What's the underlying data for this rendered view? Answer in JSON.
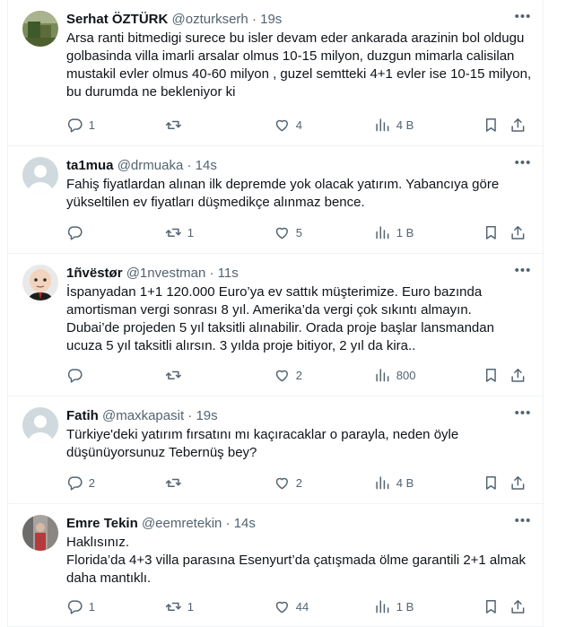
{
  "tweets": [
    {
      "name": "Serhat ÖZTÜRK",
      "handle": "@ozturkserh",
      "dot": "·",
      "time": "19s",
      "text": "Arsa ranti bitmedigi surece bu isler devam eder ankarada arazinin bol oldugu golbasinda villa imarli arsalar olmus 10-15 milyon, duzgun mimarla calisilan mustakil evler olmus 40-60 milyon , guzel semtteki 4+1 evler ise 10-15 milyon, bu durumda ne bekleniyor ki",
      "replies": "1",
      "retweets": "",
      "likes": "4",
      "views": "4 B"
    },
    {
      "name": "ta1mua",
      "handle": "@drmuaka",
      "dot": "·",
      "time": "14s",
      "text": "Fahiş fiyatlardan alınan ilk depremde yok olacak yatırım. Yabancıya göre yükseltilen ev fiyatları düşmedikçe alınmaz bence.",
      "replies": "",
      "retweets": "1",
      "likes": "5",
      "views": "1 B"
    },
    {
      "name": "1ñvëstør",
      "handle": "@1nvestman",
      "dot": "·",
      "time": "11s",
      "text": "İspanyadan 1+1 120.000 Euro’ya ev sattık müşterimize. Euro bazında amortisman vergi sonrası 8 yıl. Amerika’da vergi çok sıkıntı almayın.\nDubai’de projeden 5 yıl taksitli alınabilir. Orada proje başlar lansmandan ucuza 5 yıl taksitli alırsın. 3 yılda proje bitiyor, 2 yıl da kira..",
      "replies": "",
      "retweets": "",
      "likes": "2",
      "views": "800"
    },
    {
      "name": "Fatih",
      "handle": "@maxkapasit",
      "dot": "·",
      "time": "19s",
      "text": "Türkiye'deki yatırım fırsatını mı kaçıracaklar o parayla, neden öyle düşünüyorsunuz Tebernüş bey?",
      "replies": "2",
      "retweets": "",
      "likes": "2",
      "views": "4 B"
    },
    {
      "name": "Emre Tekin",
      "handle": "@eemretekin",
      "dot": "·",
      "time": "14s",
      "text": "Haklısınız.\nFlorida’da 4+3 villa parasına Esenyurt’da çatışmada ölme garantili 2+1 almak daha mantıklı.",
      "replies": "1",
      "retweets": "1",
      "likes": "44",
      "views": "1 B"
    }
  ],
  "colors": {
    "text": "#0f1419",
    "secondary": "#536471",
    "border": "#eff3f4",
    "default_avatar": "#cfd9de"
  },
  "icons": [
    "reply-icon",
    "retweet-icon",
    "like-icon",
    "views-icon",
    "bookmark-icon",
    "share-icon",
    "more-icon"
  ]
}
